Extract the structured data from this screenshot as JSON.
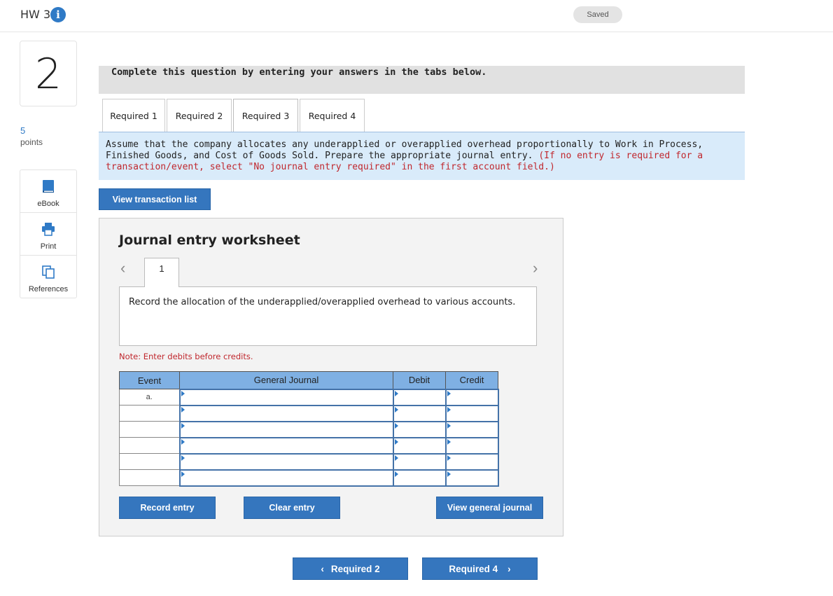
{
  "header": {
    "assignment_title": "HW 3",
    "info_icon": "info-icon",
    "save_status": "Saved"
  },
  "question": {
    "number": "2",
    "points_value": "5",
    "points_label": "points"
  },
  "rail": {
    "items": [
      {
        "label": "eBook",
        "icon": "book-icon"
      },
      {
        "label": "Print",
        "icon": "printer-icon"
      },
      {
        "label": "References",
        "icon": "copy-documents-icon"
      }
    ]
  },
  "banner": "Complete this question by entering your answers in the tabs below.",
  "tabs": [
    {
      "label": "Required 1",
      "active": false
    },
    {
      "label": "Required 2",
      "active": false
    },
    {
      "label": "Required 3",
      "active": true
    },
    {
      "label": "Required 4",
      "active": false
    }
  ],
  "instructions": {
    "text": "Assume that the company allocates any underapplied or overapplied overhead proportionally to Work in Process, Finished Goods, and Cost of Goods Sold. Prepare the appropriate journal entry.",
    "hint": "(If no entry is required for a transaction/event, select \"No journal entry required\" in the first account field.)"
  },
  "view_transactions_label": "View transaction list",
  "worksheet": {
    "title": "Journal entry worksheet",
    "page_number": "1",
    "description": "Record the allocation of the underapplied/overapplied overhead to various accounts.",
    "note": "Note: Enter debits before credits.",
    "columns": [
      "Event",
      "General Journal",
      "Debit",
      "Credit"
    ],
    "rows": [
      {
        "event": "a.",
        "account": "",
        "debit": "",
        "credit": ""
      },
      {
        "event": "",
        "account": "",
        "debit": "",
        "credit": ""
      },
      {
        "event": "",
        "account": "",
        "debit": "",
        "credit": ""
      },
      {
        "event": "",
        "account": "",
        "debit": "",
        "credit": ""
      },
      {
        "event": "",
        "account": "",
        "debit": "",
        "credit": ""
      },
      {
        "event": "",
        "account": "",
        "debit": "",
        "credit": ""
      }
    ],
    "record_label": "Record entry",
    "clear_label": "Clear entry",
    "view_journal_label": "View general journal"
  },
  "nav": {
    "prev_label": "Required 2",
    "next_label": "Required 4"
  },
  "colors": {
    "accent_blue": "#3576be",
    "instruction_bg": "#d9ebfa",
    "table_header": "#7fb0e3",
    "hint_red": "#c0272d"
  }
}
